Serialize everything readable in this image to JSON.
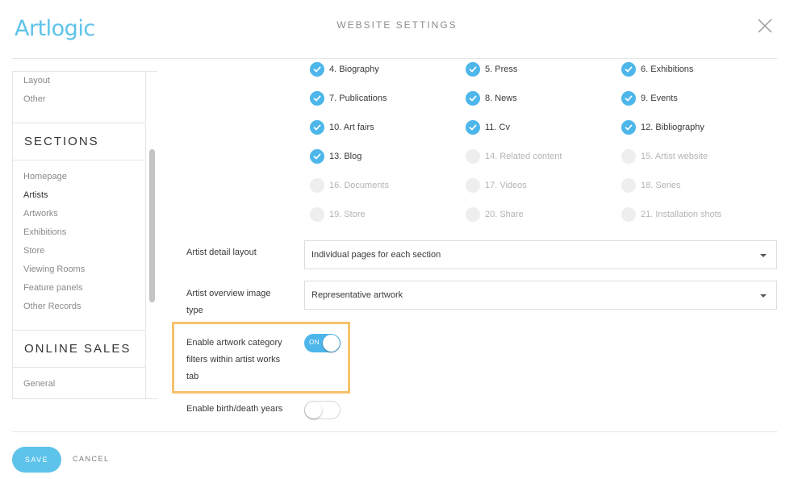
{
  "app": {
    "logo_text": "Artlogic",
    "title": "WEBSITE SETTINGS",
    "close_icon": "close-icon"
  },
  "sidebar": {
    "top_links": [
      {
        "label": "Layout",
        "active": false
      },
      {
        "label": "Other",
        "active": false
      }
    ],
    "sections_heading": "SECTIONS",
    "section_links": [
      {
        "label": "Homepage",
        "active": false
      },
      {
        "label": "Artists",
        "active": true
      },
      {
        "label": "Artworks",
        "active": false
      },
      {
        "label": "Exhibitions",
        "active": false
      },
      {
        "label": "Store",
        "active": false
      },
      {
        "label": "Viewing Rooms",
        "active": false
      },
      {
        "label": "Feature panels",
        "active": false
      },
      {
        "label": "Other Records",
        "active": false
      }
    ],
    "online_sales_heading": "ONLINE SALES",
    "online_sales_links": [
      {
        "label": "General",
        "active": false
      }
    ]
  },
  "artist_sections": [
    {
      "label": "4. Biography",
      "checked": true
    },
    {
      "label": "5. Press",
      "checked": true
    },
    {
      "label": "6. Exhibitions",
      "checked": true
    },
    {
      "label": "7. Publications",
      "checked": true
    },
    {
      "label": "8. News",
      "checked": true
    },
    {
      "label": "9. Events",
      "checked": true
    },
    {
      "label": "10. Art fairs",
      "checked": true
    },
    {
      "label": "11. Cv",
      "checked": true
    },
    {
      "label": "12. Bibliography",
      "checked": true
    },
    {
      "label": "13. Blog",
      "checked": true
    },
    {
      "label": "14. Related content",
      "checked": false
    },
    {
      "label": "15. Artist website",
      "checked": false
    },
    {
      "label": "16. Documents",
      "checked": false
    },
    {
      "label": "17. Videos",
      "checked": false
    },
    {
      "label": "18. Series",
      "checked": false
    },
    {
      "label": "19. Store",
      "checked": false
    },
    {
      "label": "20. Share",
      "checked": false
    },
    {
      "label": "21. Installation shots",
      "checked": false
    }
  ],
  "settings": {
    "detail_layout": {
      "label": "Artist detail layout",
      "value": "Individual pages for each section"
    },
    "overview_image": {
      "label_line1": "Artist overview image",
      "label_line2": "type",
      "value": "Representative artwork"
    },
    "category_filters": {
      "label_line1": "Enable artwork category",
      "label_line2": "filters within artist works",
      "label_line3": "tab",
      "toggle_text": "ON",
      "enabled": true
    },
    "birth_death": {
      "label": "Enable birth/death years",
      "enabled": false
    }
  },
  "footer": {
    "save_label": "SAVE",
    "cancel_label": "CANCEL"
  },
  "colors": {
    "accent": "#4db6ea",
    "highlight": "#f6c26b"
  }
}
